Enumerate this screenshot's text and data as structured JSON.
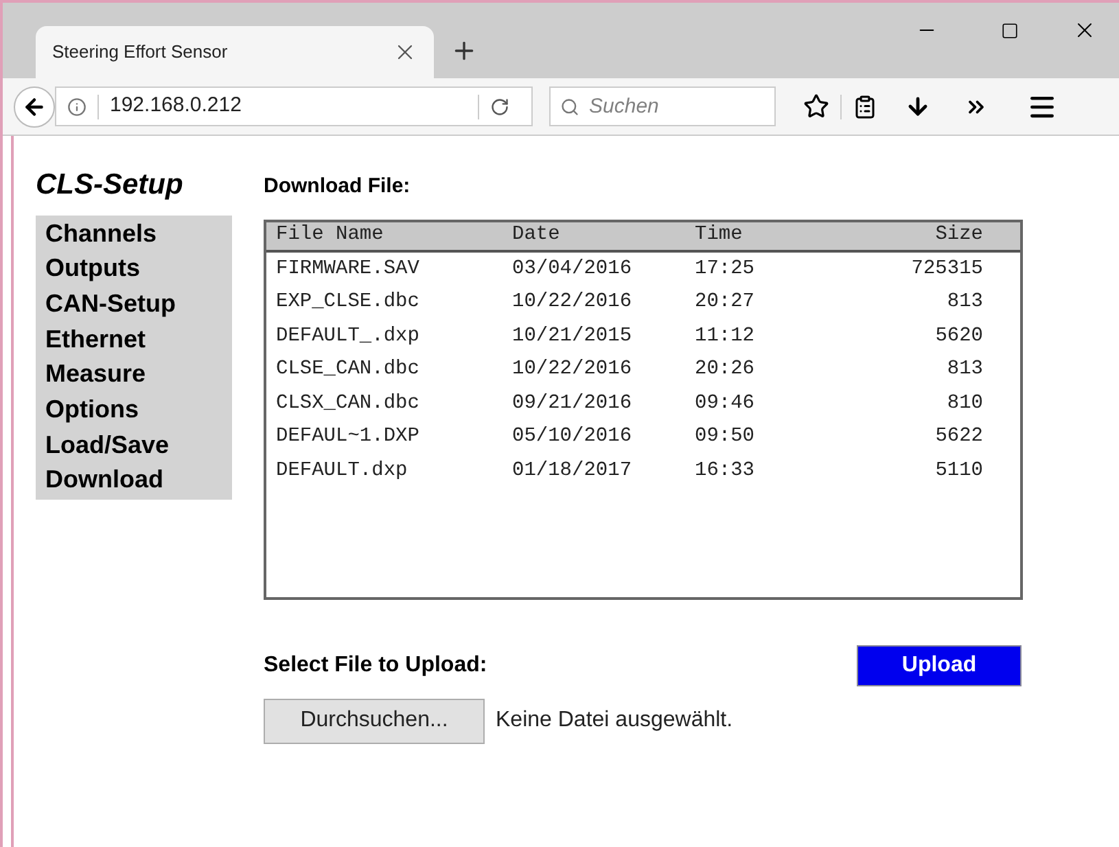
{
  "browser": {
    "tab_title": "Steering Effort Sensor",
    "address": "192.168.0.212",
    "search_placeholder": "Suchen"
  },
  "sidebar": {
    "title": "CLS-Setup",
    "items": [
      {
        "label": "Channels"
      },
      {
        "label": "Outputs"
      },
      {
        "label": "CAN-Setup"
      },
      {
        "label": "Ethernet"
      },
      {
        "label": "Measure"
      },
      {
        "label": "Options"
      },
      {
        "label": "Load/Save"
      },
      {
        "label": "Download"
      }
    ]
  },
  "download": {
    "heading": "Download File:",
    "columns": [
      "File Name",
      "Date",
      "Time",
      "Size"
    ],
    "rows": [
      [
        "FIRMWARE.SAV",
        "03/04/2016",
        "17:25",
        "725315"
      ],
      [
        "EXP_CLSE.dbc",
        "10/22/2016",
        "20:27",
        "813"
      ],
      [
        "DEFAULT_.dxp",
        "10/21/2015",
        "11:12",
        "5620"
      ],
      [
        "CLSE_CAN.dbc",
        "10/22/2016",
        "20:26",
        "813"
      ],
      [
        "CLSX_CAN.dbc",
        "09/21/2016",
        "09:46",
        "810"
      ],
      [
        "DEFAUL~1.DXP",
        "05/10/2016",
        "09:50",
        "5622"
      ],
      [
        "DEFAULT.dxp",
        "01/18/2017",
        "16:33",
        "5110"
      ]
    ]
  },
  "upload": {
    "heading": "Select File to Upload:",
    "upload_button": "Upload",
    "browse_button": "Durchsuchen...",
    "file_status": "Keine Datei ausgewählt."
  }
}
